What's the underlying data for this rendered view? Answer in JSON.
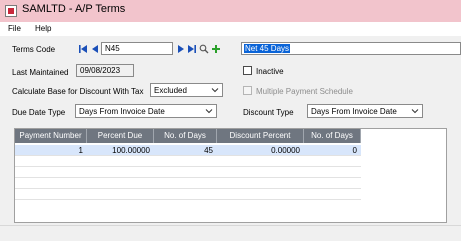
{
  "window": {
    "title": "SAMLTD - A/P Terms"
  },
  "menu": {
    "items": [
      "File",
      "Help"
    ]
  },
  "form": {
    "terms_code_label": "Terms Code",
    "terms_code_value": "N45",
    "description_value": "Net 45 Days",
    "last_maintained_label": "Last Maintained",
    "last_maintained_value": "09/08/2023",
    "inactive_label": "Inactive",
    "calc_base_label": "Calculate Base for Discount With Tax",
    "calc_base_value": "Excluded",
    "multiple_payment_label": "Multiple Payment Schedule",
    "due_date_type_label": "Due Date Type",
    "due_date_type_value": "Days From Invoice Date",
    "discount_type_label": "Discount Type",
    "discount_type_value": "Days From Invoice Date"
  },
  "grid": {
    "columns": [
      "Payment Number",
      "Percent Due",
      "No. of Days",
      "Discount Percent",
      "No. of Days"
    ],
    "rows": [
      [
        "1",
        "100.00000",
        "45",
        "0.00000",
        "0"
      ]
    ]
  },
  "colors": {
    "titlebar": "#f2c4cc",
    "grid_header": "#6f7680",
    "selected_row": "#d8e6fb",
    "nav_blue": "#1a4fb8",
    "add_green": "#2aa02a"
  },
  "icons": [
    "first-record-icon",
    "previous-record-icon",
    "next-record-icon",
    "last-record-icon",
    "search-icon",
    "add-icon",
    "chevron-down-icon"
  ]
}
